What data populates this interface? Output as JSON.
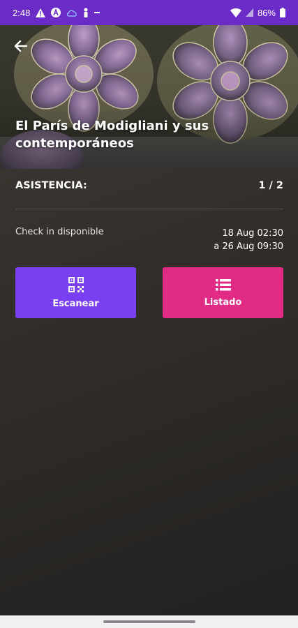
{
  "status_bar": {
    "time": "2:48",
    "battery_text": "86%",
    "icons": [
      "alert-icon",
      "app-a-icon",
      "cloud-icon",
      "person-icon",
      "dash-icon"
    ],
    "right_icons": [
      "wifi-icon",
      "signal-icon",
      "battery-icon"
    ]
  },
  "hero": {
    "title": "El París de Modigliani y sus contemporáneos",
    "back_icon": "arrow-left-icon"
  },
  "attendance": {
    "label": "ASISTENCIA:",
    "value": "1 / 2"
  },
  "checkin": {
    "label": "Check in disponible",
    "from": "18 Aug 02:30",
    "to": "a 26 Aug 09:30"
  },
  "buttons": {
    "scan_label": "Escanear",
    "scan_icon": "qr-code-icon",
    "list_label": "Listado",
    "list_icon": "list-icon"
  },
  "colors": {
    "status_bar": "#6b2bc7",
    "scan_button": "#7b3ff2",
    "list_button": "#e12b85",
    "background": "#2c2a27"
  }
}
